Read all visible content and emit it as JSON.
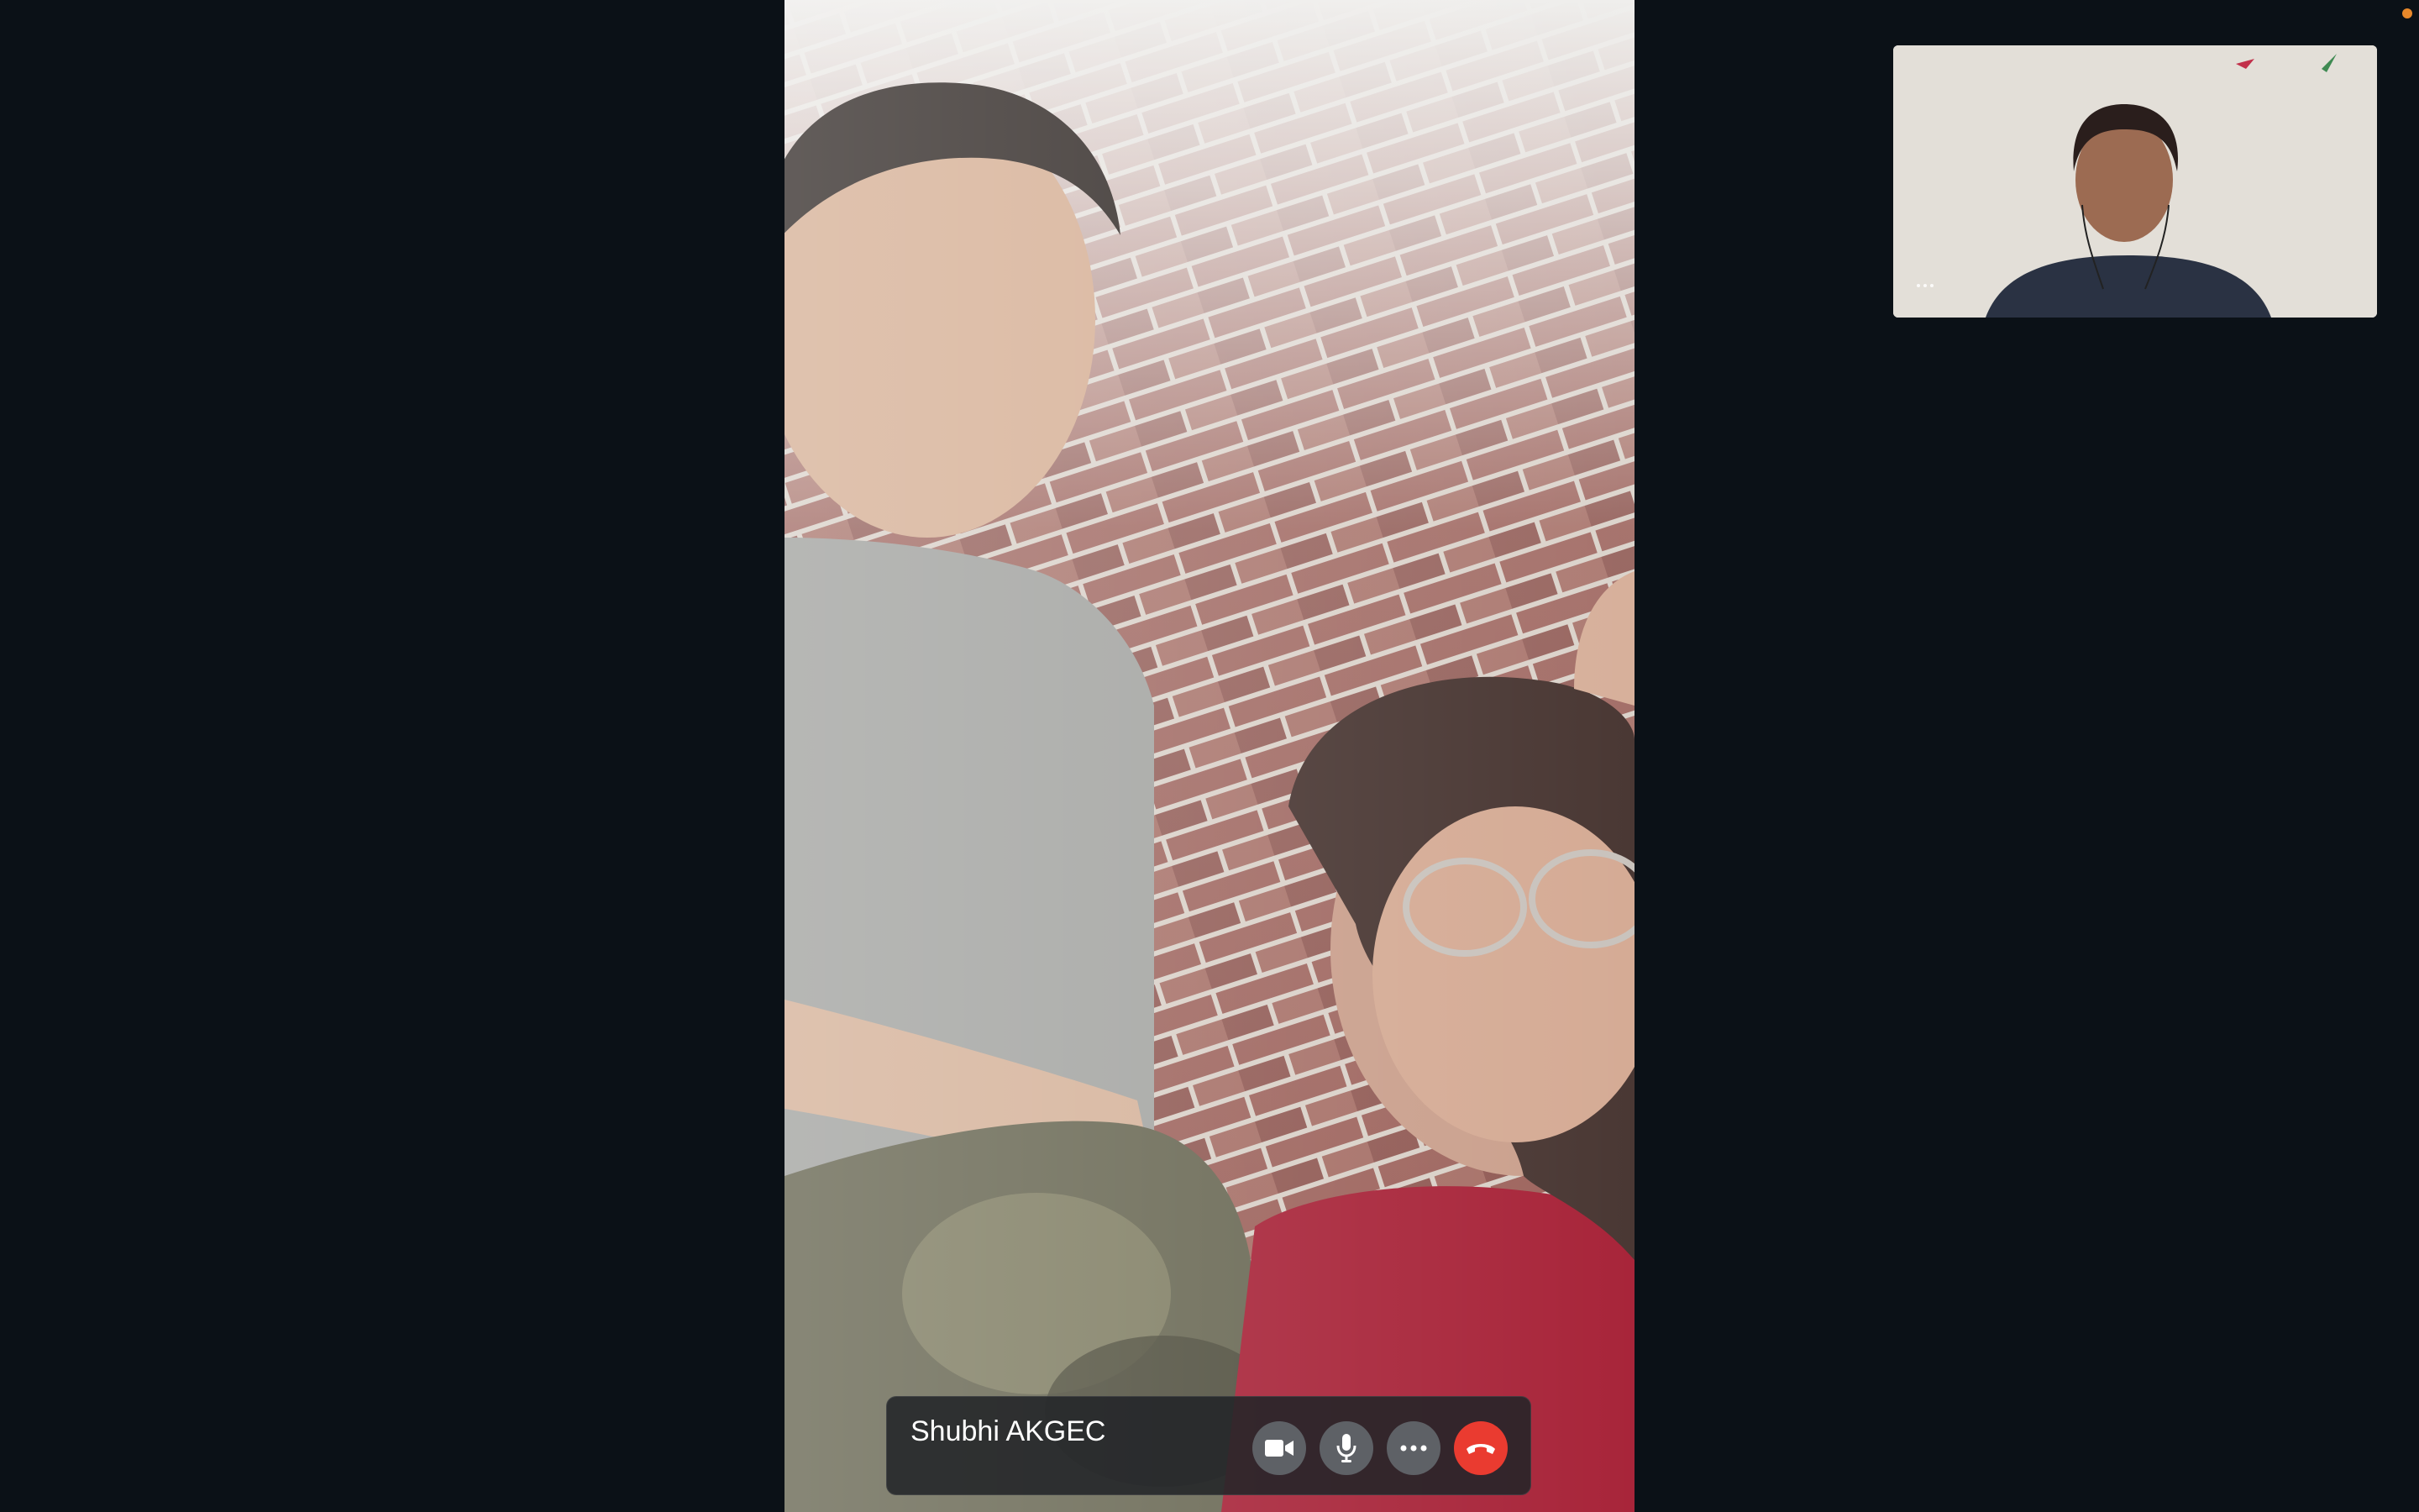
{
  "call": {
    "caller_name": "Shubhi AKGEC"
  },
  "controls": [
    {
      "name": "camera",
      "icon": "video-camera-icon"
    },
    {
      "name": "microphone",
      "icon": "microphone-icon"
    },
    {
      "name": "more",
      "icon": "more-dots-icon"
    },
    {
      "name": "end-call",
      "icon": "hang-up-icon"
    }
  ],
  "colors": {
    "background": "#0b1117",
    "control_bar": "#222428",
    "button": "#5e6166",
    "end_call": "#ea3b30",
    "recording_indicator": "#e8882a"
  }
}
